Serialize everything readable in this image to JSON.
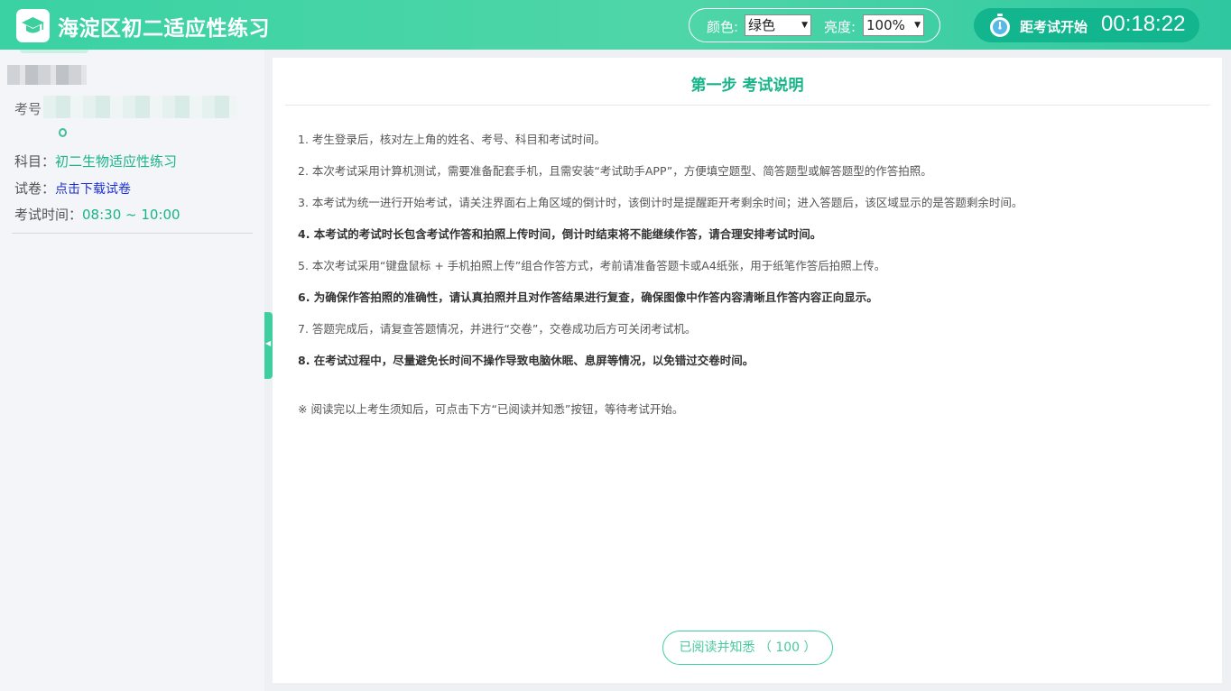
{
  "header": {
    "title": "海淀区初二适应性练习",
    "logo_icon": "graduation-cap-icon",
    "color_label": "颜色:",
    "color_value": "绿色",
    "brightness_label": "亮度:",
    "brightness_value": "100%",
    "timer_label": "距考试开始",
    "timer_value": "00:18:22",
    "timer_icon": "stopwatch-icon",
    "accent_color": "#3ad2a3"
  },
  "sidebar": {
    "id_label": "考号",
    "subject_label": "科目：",
    "subject_value": "初二生物适应性练习",
    "paper_label": "试卷：",
    "paper_link": "点击下载试卷",
    "time_label": "考试时间：",
    "time_value": "08:30 ~ 10:00"
  },
  "main": {
    "title": "第一步 考试说明",
    "rules": [
      "1. 考生登录后，核对左上角的姓名、考号、科目和考试时间。",
      "2. 本次考试采用计算机测试，需要准备配套手机，且需安装“考试助手APP”，方便填空题型、简答题型或解答题型的作答拍照。",
      "3. 本考试为统一进行开始考试，请关注界面右上角区域的倒计时，该倒计时是提醒距开考剩余时间；进入答题后，该区域显示的是答题剩余时间。",
      "4. 本考试的考试时长包含考试作答和拍照上传时间，倒计时结束将不能继续作答，请合理安排考试时间。",
      "5. 本次考试采用“键盘鼠标 + 手机拍照上传”组合作答方式，考前请准备答题卡或A4纸张，用于纸笔作答后拍照上传。",
      "6. 为确保作答拍照的准确性，请认真拍照并且对作答结果进行复查，确保图像中作答内容清晰且作答内容正向显示。",
      "7. 答题完成后，请复查答题情况，并进行“交卷”，交卷成功后方可关闭考试机。",
      "8. 在考试过程中，尽量避免长时间不操作导致电脑休眠、息屏等情况，以免错过交卷时间。"
    ],
    "note": "※ 阅读完以上考生须知后，可点击下方“已阅读并知悉”按钮，等待考试开始。",
    "confirm_button": "已阅读并知悉 （ 100 ）"
  }
}
